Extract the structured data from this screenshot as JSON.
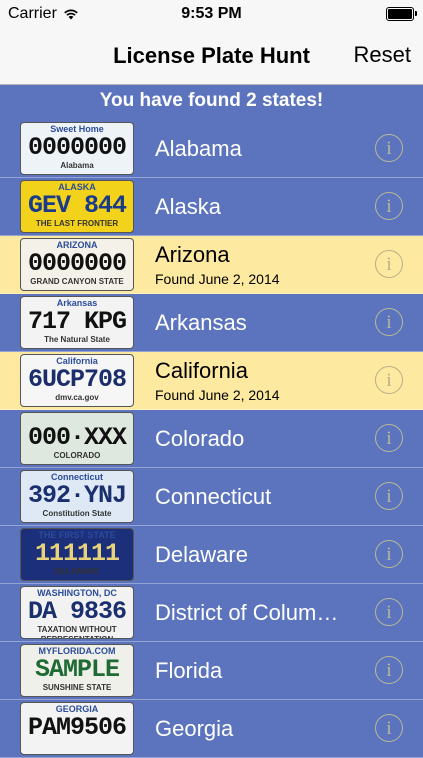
{
  "status_bar": {
    "carrier": "Carrier",
    "time": "9:53 PM"
  },
  "nav": {
    "title": "License Plate Hunt",
    "reset_label": "Reset"
  },
  "banner": {
    "text": "You have found 2 states!"
  },
  "rows": [
    {
      "name": "Alabama",
      "found": false,
      "found_text": "",
      "plate": {
        "top": "Sweet Home",
        "number": "0000000",
        "bottom": "Alabama",
        "bg": "#eef3f8",
        "color": "#111111"
      }
    },
    {
      "name": "Alaska",
      "found": false,
      "found_text": "",
      "plate": {
        "top": "ALASKA",
        "number": "GEV 844",
        "bottom": "THE LAST FRONTIER",
        "bg": "#f2d21a",
        "color": "#1a3a8a"
      }
    },
    {
      "name": "Arizona",
      "found": true,
      "found_text": "Found June 2, 2014",
      "plate": {
        "top": "ARIZONA",
        "number": "0000000",
        "bottom": "GRAND CANYON STATE",
        "bg": "#f4f1e8",
        "color": "#111111"
      }
    },
    {
      "name": "Arkansas",
      "found": false,
      "found_text": "",
      "plate": {
        "top": "Arkansas",
        "number": "717 KPG",
        "bottom": "The Natural State",
        "bg": "#f3f3f3",
        "color": "#111111"
      }
    },
    {
      "name": "California",
      "found": true,
      "found_text": "Found June 2, 2014",
      "plate": {
        "top": "California",
        "number": "6UCP708",
        "bottom": "dmv.ca.gov",
        "bg": "#f6f6f6",
        "color": "#1c2d6b"
      }
    },
    {
      "name": "Colorado",
      "found": false,
      "found_text": "",
      "plate": {
        "top": "",
        "number": "000·XXX",
        "bottom": "COLORADO",
        "bg": "#dfe8de",
        "color": "#111111"
      }
    },
    {
      "name": "Connecticut",
      "found": false,
      "found_text": "",
      "plate": {
        "top": "Connecticut",
        "number": "392·YNJ",
        "bottom": "Constitution State",
        "bg": "#dfe9f5",
        "color": "#1a2f6e"
      }
    },
    {
      "name": "Delaware",
      "found": false,
      "found_text": "",
      "plate": {
        "top": "THE FIRST STATE",
        "number": "111111",
        "bottom": "DELAWARE",
        "bg": "#1c2f7a",
        "color": "#e8d27a"
      }
    },
    {
      "name": "District of Colum…",
      "found": false,
      "found_text": "",
      "plate": {
        "top": "WASHINGTON, DC",
        "number": "DA 9836",
        "bottom": "TAXATION WITHOUT REPRESENTATION",
        "bg": "#f2f2f2",
        "color": "#1a2f6e"
      }
    },
    {
      "name": "Florida",
      "found": false,
      "found_text": "",
      "plate": {
        "top": "MYFLORIDA.COM",
        "number": "SAMPLE",
        "bottom": "SUNSHINE STATE",
        "bg": "#f0f0ea",
        "color": "#1f6b33"
      }
    },
    {
      "name": "Georgia",
      "found": false,
      "found_text": "",
      "plate": {
        "top": "GEORGIA",
        "number": "PAM9506",
        "bottom": "",
        "bg": "#f3f3f3",
        "color": "#111111"
      }
    }
  ]
}
